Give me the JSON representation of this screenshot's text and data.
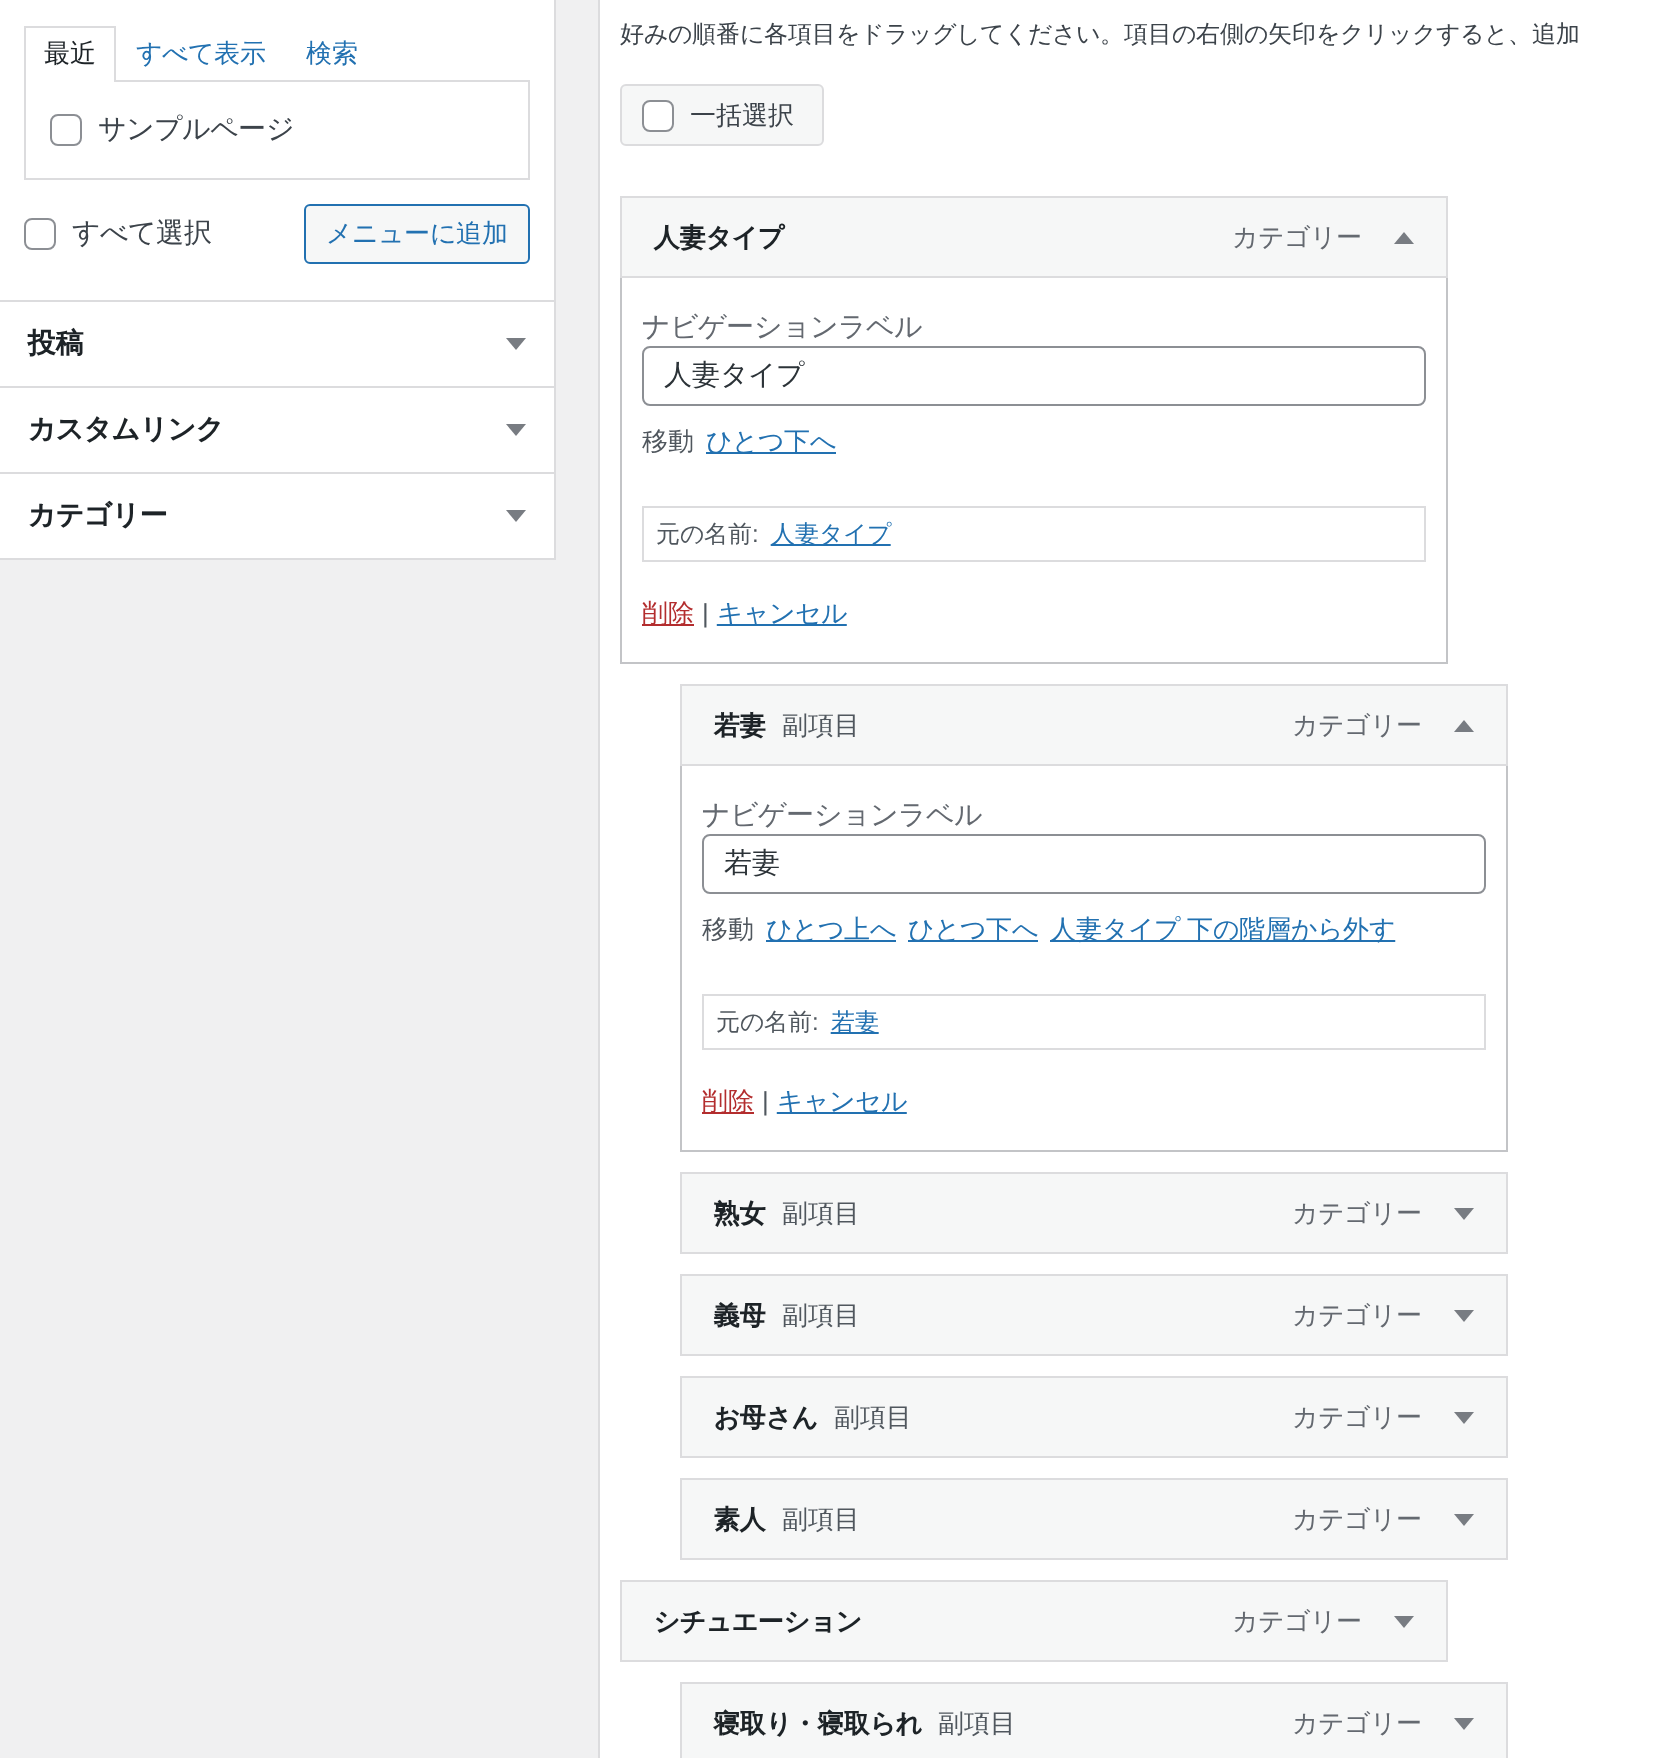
{
  "left_panel": {
    "tabs": [
      {
        "label": "最近",
        "selected": true
      },
      {
        "label": "すべて表示",
        "selected": false
      },
      {
        "label": "検索",
        "selected": false
      }
    ],
    "items": [
      {
        "label": "サンプルページ",
        "checked": false
      }
    ],
    "select_all": {
      "label": "すべて選択",
      "checked": false
    },
    "add_button": "メニューに追加",
    "sections": [
      {
        "title": "投稿",
        "expanded": false
      },
      {
        "title": "カスタムリンク",
        "expanded": false
      },
      {
        "title": "カテゴリー",
        "expanded": false
      }
    ]
  },
  "editor": {
    "instructions": "好みの順番に各項目をドラッグしてください。項目の右側の矢印をクリックすると、追加",
    "bulk_select": {
      "label": "一括選択",
      "checked": false
    },
    "menu_items": [
      {
        "title": "人妻タイプ",
        "type": "カテゴリー",
        "expanded": true,
        "settings": {
          "field_label": "ナビゲーションラベル",
          "value": "人妻タイプ",
          "move_label": "移動",
          "move_links": [
            "ひとつ下へ"
          ],
          "original_label": "元の名前:",
          "original_link": "人妻タイプ",
          "delete": "削除",
          "separator": "|",
          "cancel": "キャンセル"
        },
        "children": [
          {
            "title": "若妻",
            "subtitle": "副項目",
            "type": "カテゴリー",
            "expanded": true,
            "settings": {
              "field_label": "ナビゲーションラベル",
              "value": "若妻",
              "move_label": "移動",
              "move_links": [
                "ひとつ上へ",
                "ひとつ下へ",
                "人妻タイプ 下の階層から外す"
              ],
              "original_label": "元の名前:",
              "original_link": "若妻",
              "delete": "削除",
              "separator": "|",
              "cancel": "キャンセル"
            }
          },
          {
            "title": "熟女",
            "subtitle": "副項目",
            "type": "カテゴリー",
            "expanded": false
          },
          {
            "title": "義母",
            "subtitle": "副項目",
            "type": "カテゴリー",
            "expanded": false
          },
          {
            "title": "お母さん",
            "subtitle": "副項目",
            "type": "カテゴリー",
            "expanded": false
          },
          {
            "title": "素人",
            "subtitle": "副項目",
            "type": "カテゴリー",
            "expanded": false
          }
        ]
      },
      {
        "title": "シチュエーション",
        "type": "カテゴリー",
        "expanded": false,
        "children": [
          {
            "title": "寝取り・寝取られ",
            "subtitle": "副項目",
            "type": "カテゴリー",
            "expanded": false
          }
        ]
      }
    ]
  }
}
